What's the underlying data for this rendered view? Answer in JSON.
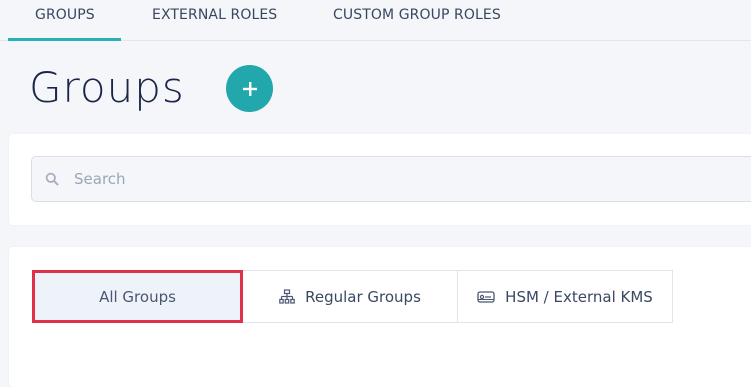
{
  "tabs": [
    {
      "label": "GROUPS",
      "active": true
    },
    {
      "label": "EXTERNAL ROLES",
      "active": false
    },
    {
      "label": "CUSTOM GROUP ROLES",
      "active": false
    }
  ],
  "page": {
    "title": "Groups",
    "add_button_icon": "plus-icon"
  },
  "search": {
    "placeholder": "Search",
    "value": "",
    "icon": "search-icon"
  },
  "filters": [
    {
      "label": "All Groups",
      "icon": "",
      "selected": true
    },
    {
      "label": "Regular Groups",
      "icon": "hierarchy-icon",
      "selected": false
    },
    {
      "label": "HSM / External KMS",
      "icon": "hsm-device-icon",
      "selected": false
    }
  ],
  "colors": {
    "accent": "#22a8ac",
    "tab_underline": "#27b0b8",
    "highlight_border": "#e0304a",
    "background": "#f4f6fa"
  }
}
